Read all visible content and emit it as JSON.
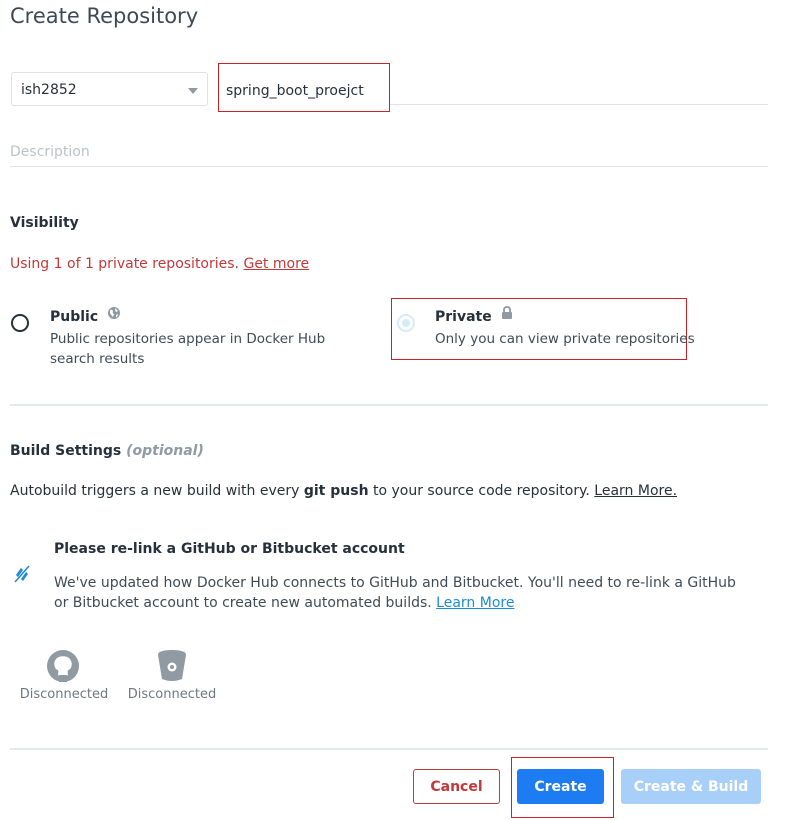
{
  "page": {
    "title": "Create Repository"
  },
  "form": {
    "namespace": {
      "value": "ish2852"
    },
    "name": {
      "value": "spring_boot_proejct"
    },
    "description": {
      "placeholder": "Description"
    }
  },
  "visibility": {
    "label": "Visibility",
    "warning_text": "Using 1 of 1 private repositories.",
    "warning_link": "Get more",
    "public": {
      "title": "Public",
      "desc": "Public repositories appear in Docker Hub search results",
      "icon": "globe-icon"
    },
    "private": {
      "title": "Private",
      "desc": "Only you can view private repositories",
      "icon": "lock-icon",
      "selected": true
    }
  },
  "build": {
    "label": "Build Settings",
    "optional": "(optional)",
    "text_before": "Autobuild triggers a new build with every ",
    "text_bold": "git push",
    "text_after": " to your source code repository.",
    "learn_more": "Learn More.",
    "relink_title": "Please re-link a GitHub or Bitbucket account",
    "relink_text": "We've updated how Docker Hub connects to GitHub and Bitbucket. You'll need to re-link a GitHub or Bitbucket account to create new automated builds.",
    "relink_link": "Learn More",
    "providers": [
      {
        "icon": "github-icon",
        "status": "Disconnected"
      },
      {
        "icon": "bitbucket-icon",
        "status": "Disconnected"
      }
    ]
  },
  "actions": {
    "cancel": "Cancel",
    "create": "Create",
    "create_build": "Create & Build"
  },
  "colors": {
    "primary": "#1d7cf2",
    "danger": "#c2393a",
    "link": "#1d8bd8",
    "disabled": "#a8cff8",
    "highlight_box": "#c7212a"
  }
}
